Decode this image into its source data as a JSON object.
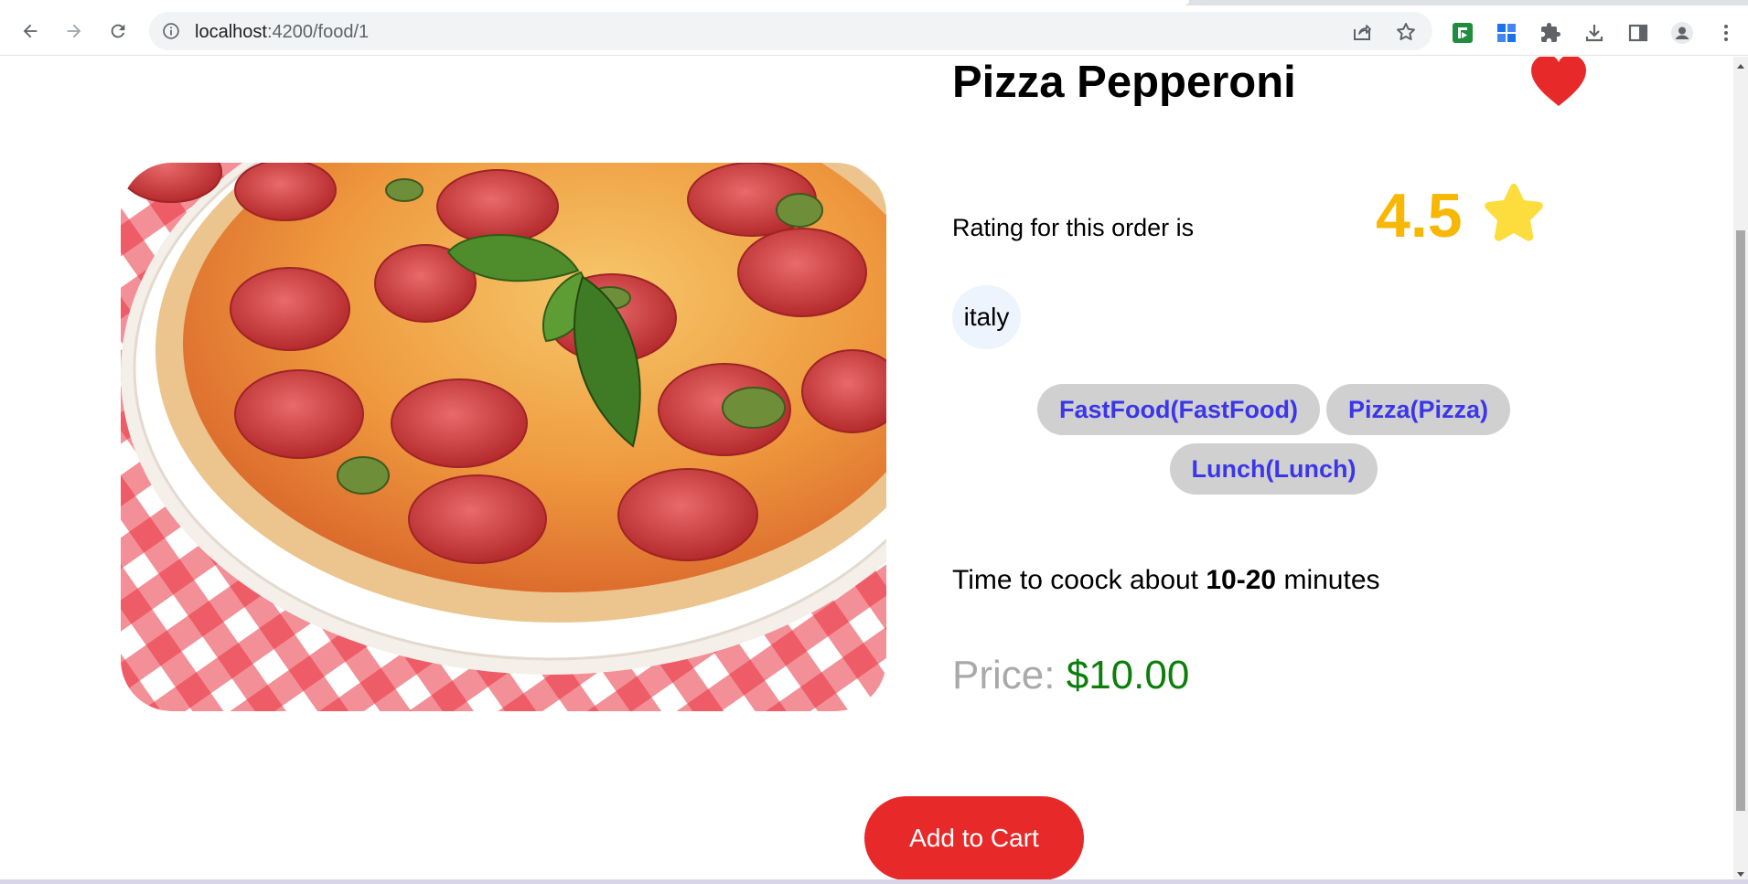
{
  "browser": {
    "url_host": "localhost",
    "url_path": ":4200/food/1"
  },
  "food": {
    "name": "Pizza Pepperoni",
    "favorite": true,
    "rating_label": "Rating for this order is",
    "rating_value": "4.5",
    "origin": "italy",
    "tags": [
      "FastFood(FastFood)",
      "Pizza(Pizza)",
      "Lunch(Lunch)"
    ],
    "cook_time_prefix": "Time to coock about",
    "cook_time_value": "10-20",
    "cook_time_suffix": "minutes",
    "price_label": "Price:",
    "price_value": "$10.00",
    "add_to_cart_label": "Add to Cart"
  },
  "colors": {
    "accent_red": "#e72929",
    "rating_yellow": "#f8b703",
    "price_green": "#0b7e0b",
    "tag_text_blue": "#3b36e9"
  },
  "icons": {
    "back": "arrow-left-icon",
    "forward": "arrow-right-icon",
    "reload": "reload-icon",
    "site_info": "info-icon",
    "share": "share-icon",
    "bookmark": "star-outline-icon",
    "favorite": "heart-icon",
    "rating": "star-icon"
  }
}
